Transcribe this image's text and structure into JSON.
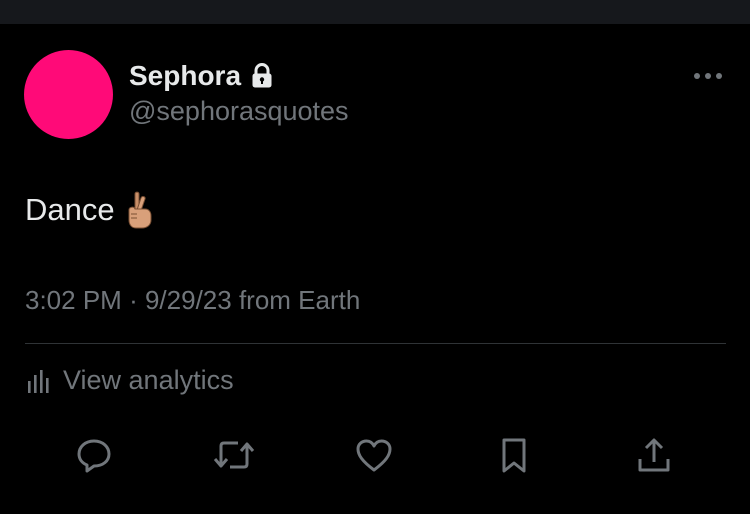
{
  "colors": {
    "background": "#000000",
    "avatar": "#ff0a78",
    "primary_text": "#e7e9ea",
    "secondary_text": "#71767b",
    "divider": "#2f3336"
  },
  "tweet": {
    "author": {
      "display_name": "Sephora",
      "handle": "@sephorasquotes",
      "protected_icon": "lock-icon"
    },
    "text": "Dance",
    "emoji": "crossed-fingers-emoji",
    "time": "3:02 PM",
    "separator": "·",
    "date": "9/29/23",
    "source": "from Earth",
    "analytics_label": "View analytics"
  },
  "actions": [
    {
      "name": "reply",
      "icon": "reply-icon"
    },
    {
      "name": "retweet",
      "icon": "retweet-icon"
    },
    {
      "name": "like",
      "icon": "heart-icon"
    },
    {
      "name": "bookmark",
      "icon": "bookmark-icon"
    },
    {
      "name": "share",
      "icon": "share-icon"
    }
  ]
}
